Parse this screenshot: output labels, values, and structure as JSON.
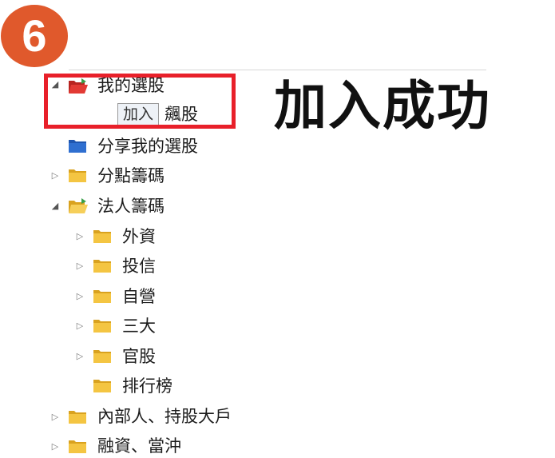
{
  "step_badge": "6",
  "success_message": "加入成功",
  "tree": {
    "my_stocks": "我的選股",
    "new_item_edit": "加入",
    "new_item_rest": "飆股",
    "share_my_stocks": "分享我的選股",
    "broker_chips": "分點籌碼",
    "institutional_chips": "法人籌碼",
    "foreign": "外資",
    "investment_trust": "投信",
    "dealer": "自營",
    "big_three": "三大",
    "gov_stocks": "官股",
    "ranking": "排行榜",
    "insiders": "內部人、持股大戶",
    "margin": "融資、當沖"
  },
  "colors": {
    "badge": "#e0592c",
    "highlight_border": "#e8202a",
    "folder_yellow": "#f4c542",
    "folder_red": "#d9302c",
    "folder_blue": "#2f6fd0"
  }
}
